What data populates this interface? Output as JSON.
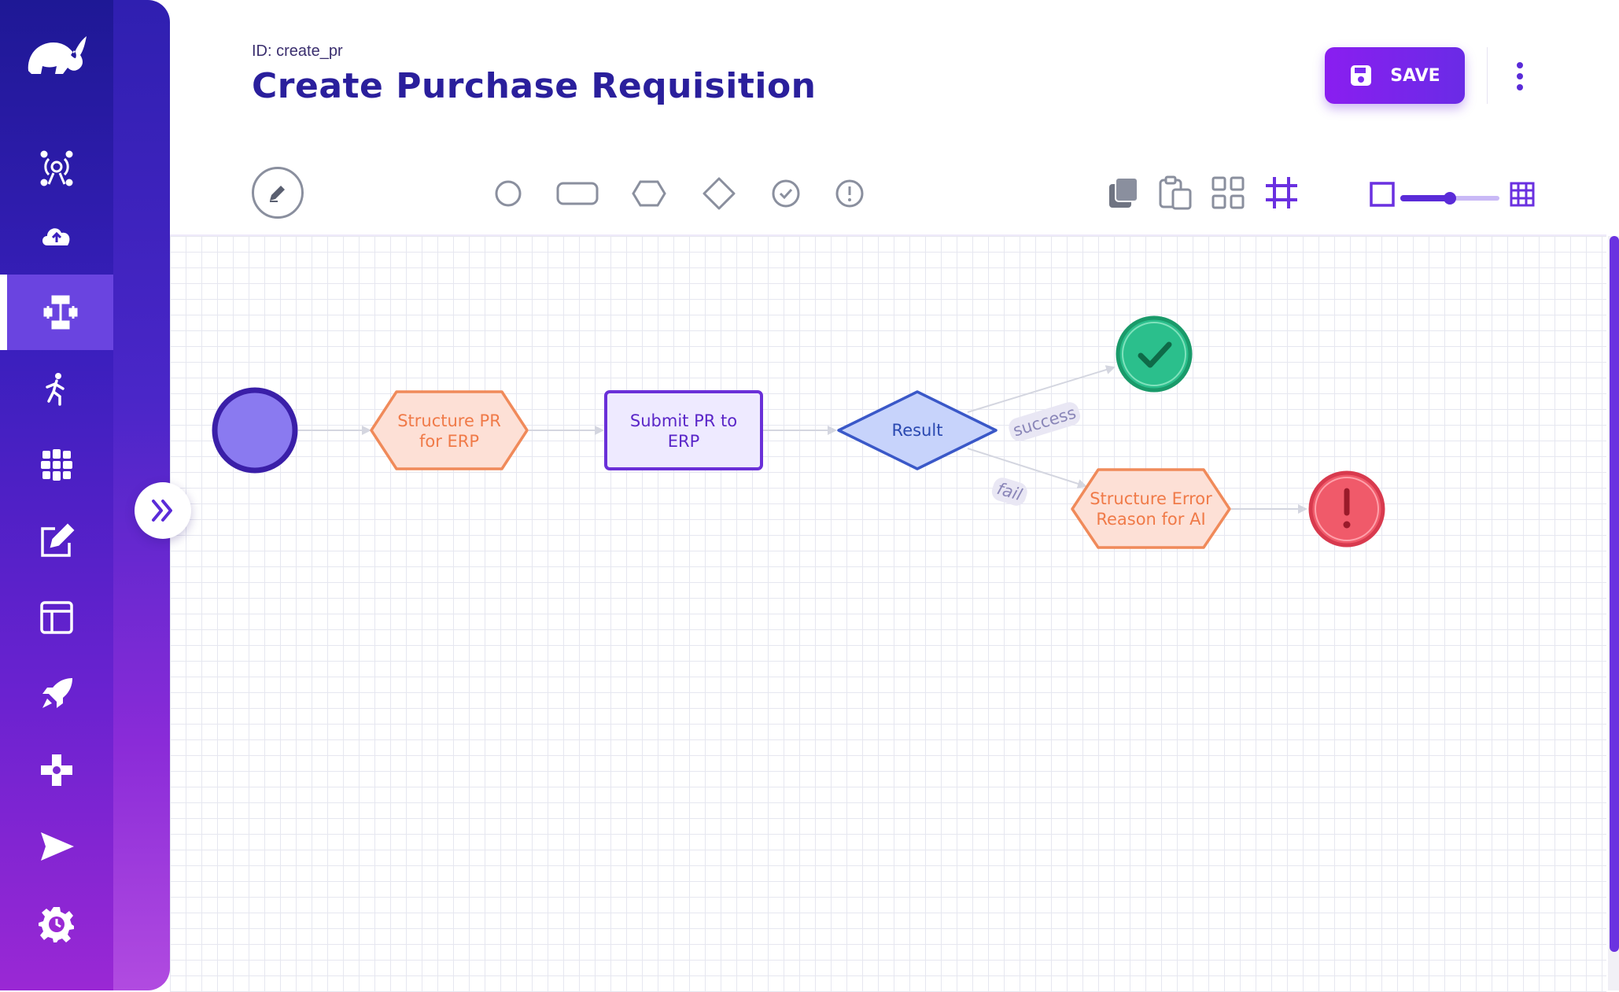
{
  "header": {
    "id_text": "ID: create_pr",
    "title": "Create Purchase Requisition",
    "save_label": "SAVE"
  },
  "sidebar": {
    "items": [
      {
        "icon": "signal-tower-icon",
        "active": false
      },
      {
        "icon": "cloud-upload-icon",
        "active": false
      },
      {
        "icon": "workflow-icon",
        "active": true
      },
      {
        "icon": "running-person-icon",
        "active": false
      },
      {
        "icon": "globe-grid-icon",
        "active": false
      },
      {
        "icon": "edit-icon",
        "active": false
      },
      {
        "icon": "layout-icon",
        "active": false
      },
      {
        "icon": "rocket-icon",
        "active": false
      },
      {
        "icon": "gamepad-icon",
        "active": false
      },
      {
        "icon": "send-icon",
        "active": false
      },
      {
        "icon": "settings-clock-icon",
        "active": false
      }
    ]
  },
  "toolbar": {
    "shapes": [
      "circle-shape-icon",
      "rounded-rect-shape-icon",
      "hexagon-shape-icon",
      "diamond-shape-icon",
      "check-circle-shape-icon",
      "exclamation-circle-shape-icon"
    ],
    "actions": [
      "copy-icon",
      "paste-icon",
      "grid-layout-icon",
      "snap-grid-icon"
    ],
    "zoom_level": 0.5
  },
  "flow": {
    "nodes": {
      "start": {
        "type": "start"
      },
      "structure_pr": {
        "type": "hexagon",
        "line1": "Structure PR",
        "line2": "for ERP"
      },
      "submit_pr": {
        "type": "task",
        "line1": "Submit PR to",
        "line2": "ERP"
      },
      "result": {
        "type": "decision",
        "label": "Result"
      },
      "success_end": {
        "type": "success"
      },
      "structure_error": {
        "type": "hexagon",
        "line1": "Structure Error",
        "line2": "Reason for AI"
      },
      "error_end": {
        "type": "error"
      }
    },
    "edges": {
      "success_label": "success",
      "fail_label": "fail"
    }
  },
  "colors": {
    "primary": "#2a1f9c",
    "accent": "#7a2bf0",
    "hexagon_stroke": "#f08a5a",
    "hexagon_fill": "#fde0d6",
    "task_stroke": "#6a30d8",
    "task_fill": "#eeeaff",
    "decision_stroke": "#3a58c8",
    "decision_fill": "#c7d3fb",
    "success": "#2bbf8c",
    "error": "#f05a6a"
  }
}
